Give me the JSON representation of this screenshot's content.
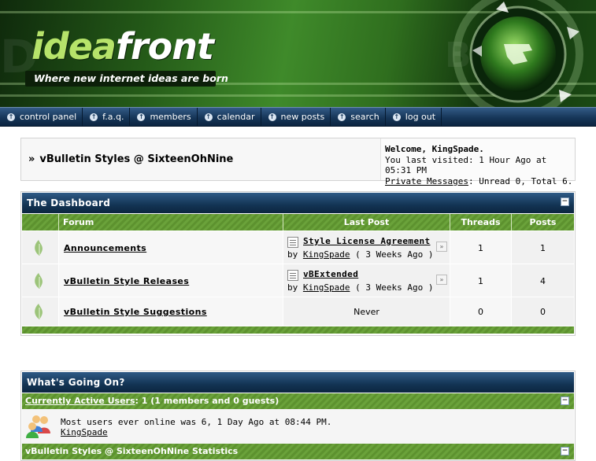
{
  "header": {
    "logo_idea": "idea",
    "logo_front": "front",
    "tagline": "Where new internet ideas are born"
  },
  "navbar": {
    "items": [
      {
        "label": "control panel"
      },
      {
        "label": "f.a.q."
      },
      {
        "label": "members"
      },
      {
        "label": "calendar"
      },
      {
        "label": "new posts"
      },
      {
        "label": "search"
      },
      {
        "label": "log out"
      }
    ]
  },
  "breadcrumb": {
    "prefix": "»",
    "title": "vBulletin Styles @ SixteenOhNine"
  },
  "welcome": {
    "greeting": "Welcome, KingSpade.",
    "last_visited": "You last visited: 1 Hour Ago at 05:31 PM",
    "pm_link": "Private Messages",
    "pm_status": ": Unread 0, Total 6."
  },
  "dashboard": {
    "title": "The Dashboard",
    "collapse": "−",
    "columns": {
      "forum": "Forum",
      "last_post": "Last Post",
      "threads": "Threads",
      "posts": "Posts"
    },
    "forums": [
      {
        "name": "Announcements",
        "last_post_title": "Style License Agreement",
        "by": "by",
        "user": "KingSpade",
        "time": "( 3 Weeks Ago )",
        "threads": "1",
        "posts": "1"
      },
      {
        "name": "vBulletin Style Releases",
        "last_post_title": "vBExtended",
        "by": "by",
        "user": "KingSpade",
        "time": "( 3 Weeks Ago )",
        "threads": "1",
        "posts": "4"
      },
      {
        "name": "vBulletin Style Suggestions",
        "last_post_never": "Never",
        "threads": "0",
        "posts": "0"
      }
    ]
  },
  "whats_going_on": {
    "title": "What's Going On?",
    "active_users_link": "Currently Active Users",
    "active_users_count": ": 1 (1 members and 0 guests)",
    "most_online": "Most users ever online was 6, 1 Day Ago at 08:44 PM.",
    "online_user": "KingSpade",
    "stats_title": "vBulletin Styles @ SixteenOhNine Statistics",
    "collapse": "−"
  },
  "colors": {
    "nav_blue": "#163658",
    "cat_blue": "#133454",
    "green_stripe": "#6aa23a"
  }
}
